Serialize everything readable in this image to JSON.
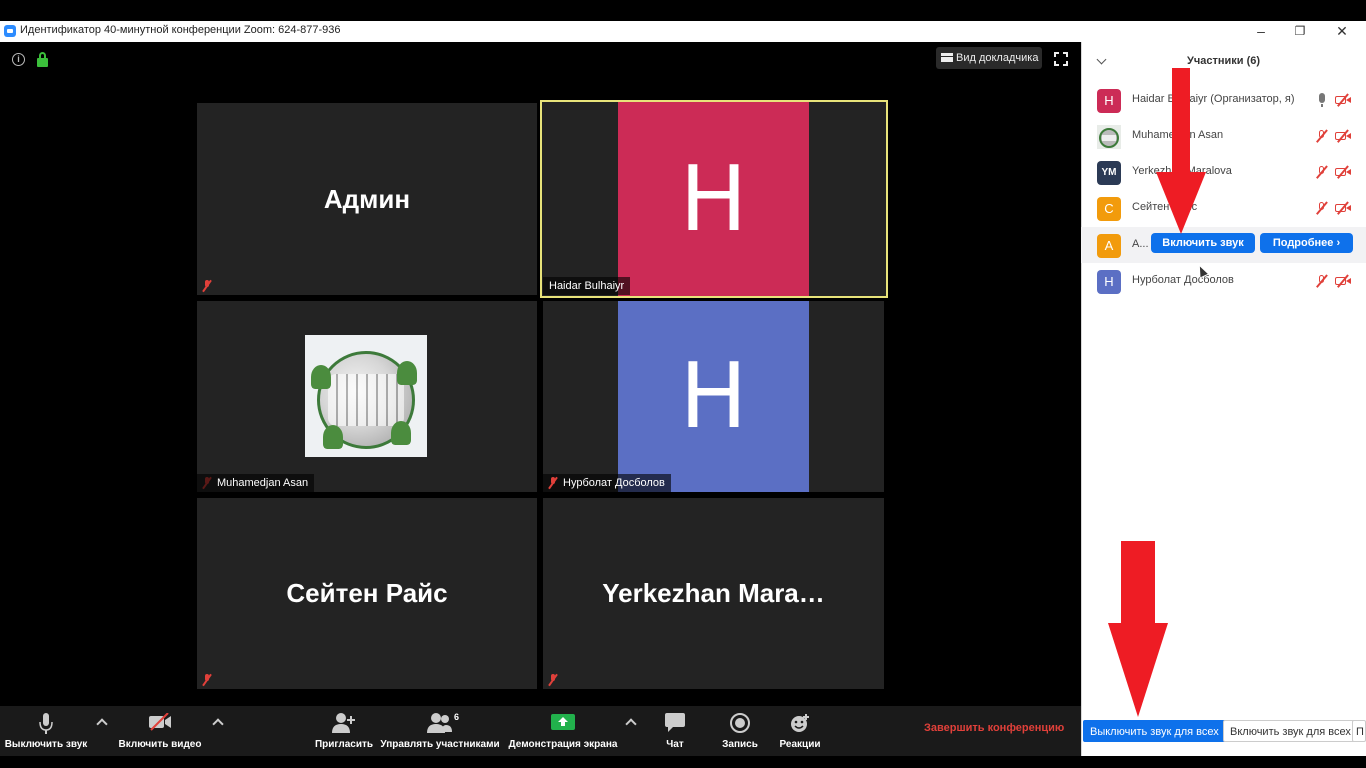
{
  "window": {
    "title": "Идентификатор 40-минутной конференции Zoom: 624-877-936",
    "minimize": "–",
    "maximize": "❐",
    "close": "✕"
  },
  "video": {
    "speaker_view_label": "Вид докладчика",
    "tiles": [
      {
        "display": "Админ",
        "nametag": ""
      },
      {
        "display": "H",
        "nametag": "Haidar Bulhaiyr",
        "avatar_color": "#cc2b56"
      },
      {
        "display": "",
        "nametag": "Muhamedjan Asan"
      },
      {
        "display": "H",
        "nametag": "Нурболат Досболов",
        "avatar_color": "#5b6fc4"
      },
      {
        "display": "Сейтен Райс",
        "nametag": ""
      },
      {
        "display": "Yerkezhan  Mara…",
        "nametag": ""
      }
    ]
  },
  "toolbar": {
    "mute_label": "Выключить звук",
    "video_label": "Включить видео",
    "invite_label": "Пригласить",
    "participants_label": "Управлять участниками",
    "participants_count": "6",
    "share_label": "Демонстрация экрана",
    "chat_label": "Чат",
    "record_label": "Запись",
    "reactions_label": "Реакции",
    "end_label": "Завершить конференцию"
  },
  "panel": {
    "title": "Участники (6)",
    "participants": [
      {
        "initials": "H",
        "color": "#cc2b56",
        "name": "Haidar Bulhaiyr (Организатор, я)",
        "mic": "on"
      },
      {
        "initials": "",
        "color": "#8a9a7a",
        "name": "Muhamedjan Asan",
        "mic": "off"
      },
      {
        "initials": "YM",
        "color": "#2b3a55",
        "name": "Yerkezhan Maralova",
        "mic": "off"
      },
      {
        "initials": "С",
        "color": "#f29b0c",
        "name": "Сейтен Райс",
        "mic": "off"
      },
      {
        "initials": "А",
        "color": "#f29b0c",
        "name": "А...",
        "mic": "hover"
      },
      {
        "initials": "Н",
        "color": "#5b6fc4",
        "name": "Нурболат Досболов",
        "mic": "off"
      }
    ],
    "unmute_btn": "Включить звук",
    "more_btn": "Подробнее ›",
    "mute_all": "Выключить звук для всех",
    "unmute_all": "Включить звук для всех",
    "more_short": "П"
  },
  "colors": {
    "accent": "#0e71eb",
    "end_red": "#e0403a",
    "arrow_red": "#ee1c24",
    "speaker_border": "#e8e37a"
  }
}
